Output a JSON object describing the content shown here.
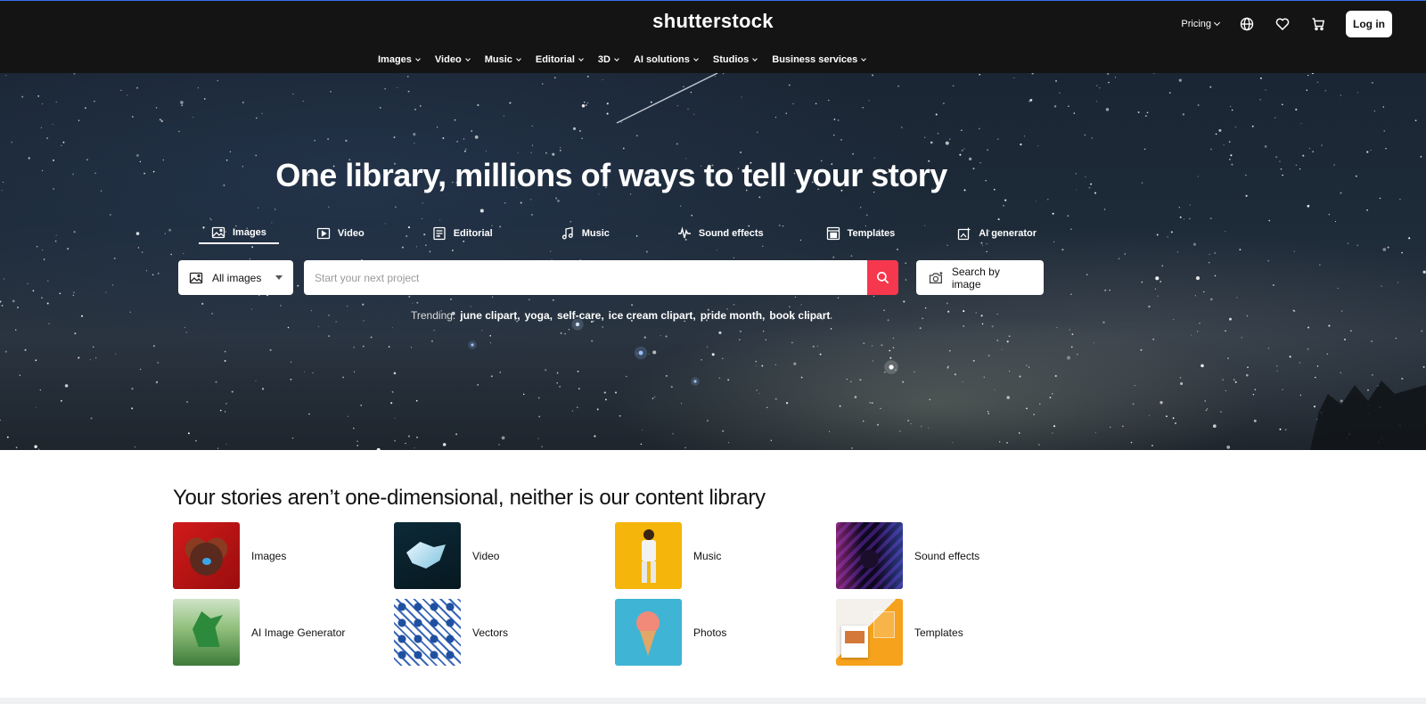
{
  "header": {
    "logo": "shutterstock",
    "pricing_label": "Pricing",
    "login_label": "Log in",
    "icons": [
      "globe-icon",
      "heart-icon",
      "cart-icon"
    ],
    "accent_color": "#3a6df0"
  },
  "nav": {
    "items": [
      {
        "label": "Images"
      },
      {
        "label": "Video"
      },
      {
        "label": "Music"
      },
      {
        "label": "Editorial"
      },
      {
        "label": "3D"
      },
      {
        "label": "AI solutions"
      },
      {
        "label": "Studios"
      },
      {
        "label": "Business services"
      }
    ]
  },
  "hero": {
    "title": "One library, millions of ways to tell your story",
    "tabs": [
      {
        "label": "Images",
        "icon": "image-icon",
        "active": true
      },
      {
        "label": "Video",
        "icon": "video-icon",
        "active": false
      },
      {
        "label": "Editorial",
        "icon": "editorial-icon",
        "active": false
      },
      {
        "label": "Music",
        "icon": "music-note-icon",
        "active": false
      },
      {
        "label": "Sound effects",
        "icon": "waveform-icon",
        "active": false
      },
      {
        "label": "Templates",
        "icon": "template-icon",
        "active": false
      },
      {
        "label": "AI generator",
        "icon": "ai-generator-icon",
        "active": false
      }
    ],
    "search": {
      "type_label": "All images",
      "placeholder": "Start your next project",
      "value": "",
      "search_by_image_label": "Search by image",
      "button_color": "#f5384e"
    },
    "trending": {
      "label": "Trending:",
      "terms": [
        "june clipart,",
        "yoga,",
        "self-care,",
        "ice cream clipart,",
        "pride month,",
        "book clipart"
      ]
    }
  },
  "content": {
    "title": "Your stories aren’t one-dimensional, neither is our content library",
    "cards": [
      {
        "label": "Images"
      },
      {
        "label": "Video"
      },
      {
        "label": "Music"
      },
      {
        "label": "Sound effects"
      },
      {
        "label": "AI Image Generator"
      },
      {
        "label": "Vectors"
      },
      {
        "label": "Photos"
      },
      {
        "label": "Templates"
      }
    ]
  }
}
